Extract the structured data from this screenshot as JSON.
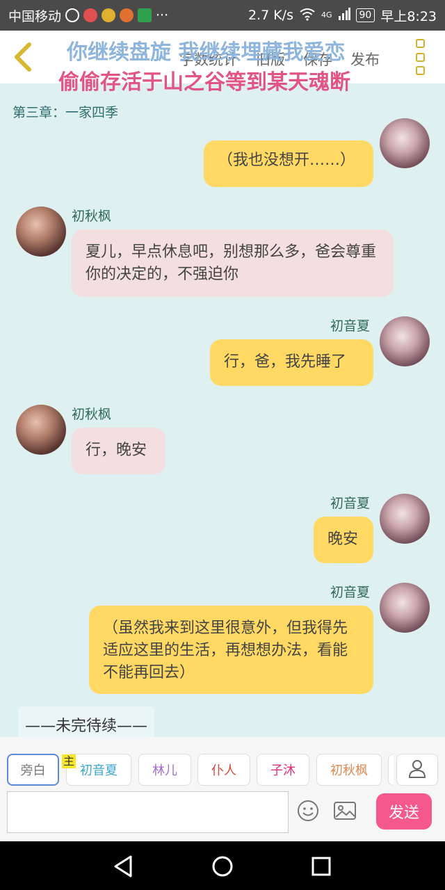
{
  "status_bar": {
    "carrier": "中国移动",
    "speed": "2.7 K/s",
    "network": "4G",
    "battery": "90",
    "time": "早上8:23",
    "overflow": "···"
  },
  "header": {
    "toolbar": [
      "字数统计",
      "旧版",
      "保存",
      "发布"
    ]
  },
  "lyrics": {
    "line1": "你继续盘旋 我继续埋藏我爱恋",
    "line2": "偷偷存活于山之谷等到某天魂断"
  },
  "chapter_title": "第三章：一家四季",
  "messages": [
    {
      "speaker": "",
      "side": "right",
      "text": "（我也没想开……）"
    },
    {
      "speaker": "初秋枫",
      "side": "left",
      "text": "夏儿，早点休息吧，别想那么多，爸会尊重你的决定的，不强迫你"
    },
    {
      "speaker": "初音夏",
      "side": "right",
      "text": "行，爸，我先睡了"
    },
    {
      "speaker": "初秋枫",
      "side": "left",
      "text": "行，晚安"
    },
    {
      "speaker": "初音夏",
      "side": "right",
      "text": "晚安"
    },
    {
      "speaker": "初音夏",
      "side": "right",
      "text": "（虽然我来到这里很意外，但我得先适应这里的生活，再想想办法，看能不能再回去）"
    }
  ],
  "to_be_continued": "——未完待续——",
  "roles": {
    "main_tag": "主",
    "items": [
      {
        "label": "旁白",
        "color": "#777777"
      },
      {
        "label": "初音夏",
        "color": "#3ba7c8"
      },
      {
        "label": "林儿",
        "color": "#a36ad0"
      },
      {
        "label": "仆人",
        "color": "#d04a3a"
      },
      {
        "label": "子沐",
        "color": "#e0307a"
      },
      {
        "label": "初秋枫",
        "color": "#e08850"
      }
    ]
  },
  "composer": {
    "placeholder": "",
    "send_label": "发送"
  },
  "colors": {
    "bubble_self": "#ffd964",
    "bubble_other": "#f3dfe0",
    "send": "#f4588c",
    "background": "#dff0f0"
  }
}
